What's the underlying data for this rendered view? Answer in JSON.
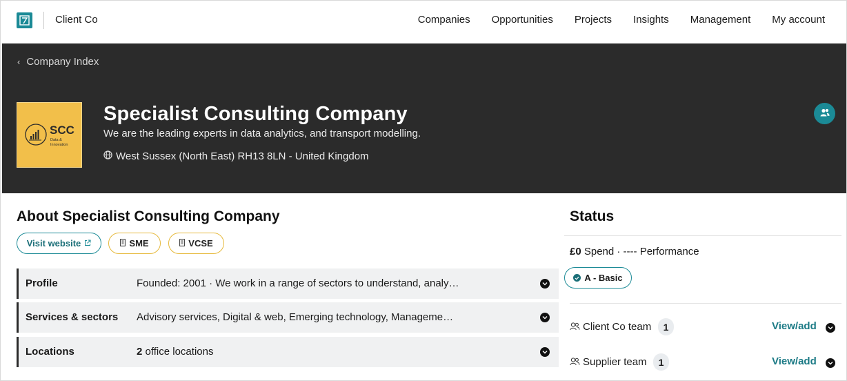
{
  "colors": {
    "accent": "#1b8a96",
    "hero_bg": "#2b2b2b",
    "logo_bg": "#f2bf4a",
    "badge_border": "#e6b93c"
  },
  "header": {
    "logo_icon": "app-logo-icon",
    "client_name": "Client Co",
    "nav": [
      "Companies",
      "Opportunities",
      "Projects",
      "Insights",
      "Management",
      "My account"
    ]
  },
  "hero": {
    "breadcrumb": "Company Index",
    "logo": {
      "text": "SCC",
      "subtext": "Data & Innovation"
    },
    "company_name": "Specialist Consulting Company",
    "tagline": "We are the leading experts in data analytics, and transport modelling.",
    "location": "West Sussex (North East) RH13 8LN - United Kingdom",
    "team_button_icon": "people-icon"
  },
  "about": {
    "title": "About Specialist Consulting Company",
    "visit_website": "Visit website",
    "badges": [
      "SME",
      "VCSE"
    ],
    "rows": [
      {
        "label": "Profile",
        "value": "Founded: 2001 · We work in a range of sectors to understand, analy…"
      },
      {
        "label": "Services & sectors",
        "value": "Advisory services, Digital & web, Emerging technology, Manageme…"
      },
      {
        "label": "Locations",
        "value_bold": "2",
        "value": " office locations"
      }
    ]
  },
  "status": {
    "title": "Status",
    "spend_amount": "£0",
    "spend_rest": " Spend · ---- Performance",
    "tier": "A - Basic",
    "teams": [
      {
        "name": "Client Co team",
        "count": "1",
        "link": "View/add"
      },
      {
        "name": "Supplier team",
        "count": "1",
        "link": "View/add"
      }
    ]
  }
}
